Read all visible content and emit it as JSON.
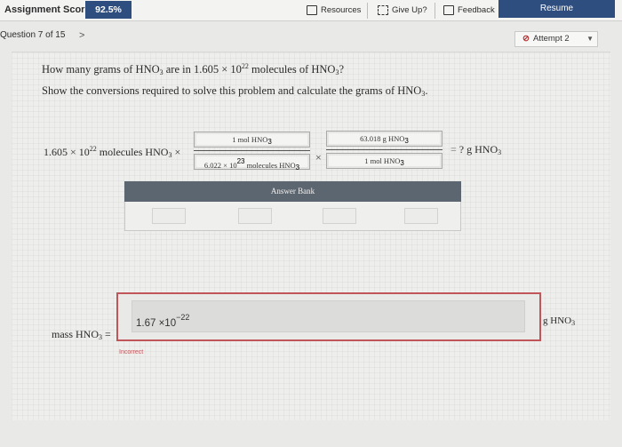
{
  "topbar": {
    "score_label": "Assignment Score:",
    "score_value": "92.5%",
    "resources": "Resources",
    "give_up": "Give Up?",
    "feedback": "Feedback",
    "resume": "Resume"
  },
  "nav": {
    "question": "Question 7 of 15",
    "next_arrow": ">",
    "attempt": "Attempt 2"
  },
  "question": {
    "line1_a": "How many grams of HNO",
    "line1_b": " are in 1.605 × 10",
    "line1_exp": "22",
    "line1_c": " molecules of HNO",
    "line1_d": "?",
    "line2_a": "Show the conversions required to solve this problem and calculate the grams of HNO",
    "line2_b": "."
  },
  "expression": {
    "start_a": "1.605 × 10",
    "start_exp": "22",
    "start_b": " molecules HNO",
    "times": "×",
    "frac1_num": "1 mol HNO",
    "frac1_den_a": "6.022 × 10",
    "frac1_den_exp": "23",
    "frac1_den_b": " molecules HNO",
    "frac2_num": "63.018 g HNO",
    "frac2_den": "1 mol HNO",
    "result_eq": "=",
    "result": "? g HNO",
    "sub3": "3"
  },
  "answer_bank": {
    "title": "Answer Bank"
  },
  "answer": {
    "label_a": "mass HNO",
    "label_b": " =",
    "value": "1.67 ×10",
    "value_exp": "−22",
    "unit": "g HNO",
    "status": "Incorrect"
  },
  "colors": {
    "accent": "#2f4e80",
    "error": "#c0555a",
    "bank_header": "#5c6670"
  }
}
